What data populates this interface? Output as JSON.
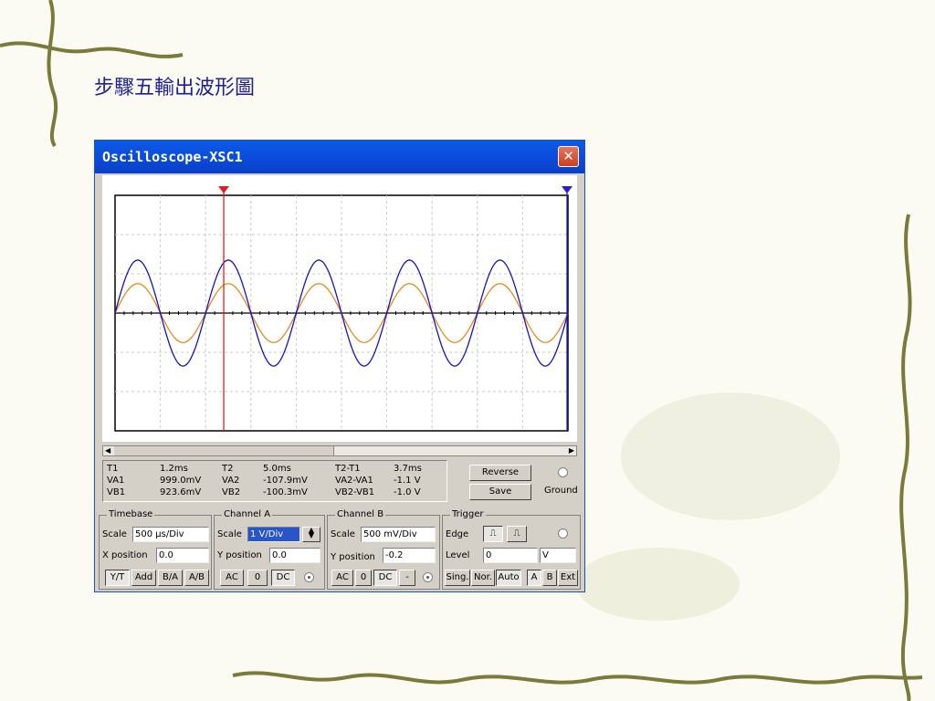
{
  "slide": {
    "title": "步驟五輸出波形圖"
  },
  "window": {
    "title": "Oscilloscope-XSC1",
    "close_glyph": "✕"
  },
  "colors": {
    "ch_a": "#e88a1a",
    "ch_b": "#1414c8",
    "cursor1": "#e02020",
    "cursor2": "#2020d0",
    "grid": "#c8c8c8",
    "titlebar": "#0b49d8"
  },
  "chart_data": {
    "type": "line",
    "x_unit": "ms",
    "xlim": [
      0,
      5.0
    ],
    "ylim": [
      -4,
      4
    ],
    "series": [
      {
        "name": "Channel A",
        "amplitude": 1.0,
        "period": 1.0,
        "phase_offset": 0.0
      },
      {
        "name": "Channel B",
        "amplitude": 1.8,
        "period": 1.0,
        "phase_offset": 0.0
      }
    ],
    "cursor_t1": 1.2,
    "cursor_t2": 5.0,
    "grid": true
  },
  "readout": {
    "t1": {
      "label": "T1",
      "time": "1.2ms",
      "va_label": "VA1",
      "va": "999.0mV",
      "vb_label": "VB1",
      "vb": "923.6mV"
    },
    "t2": {
      "label": "T2",
      "time": "5.0ms",
      "va_label": "VA2",
      "va": "-107.9mV",
      "vb_label": "VB2",
      "vb": "-100.3mV"
    },
    "diff": {
      "label": "T2-T1",
      "time": "3.7ms",
      "va_label": "VA2-VA1",
      "va": "-1.1 V",
      "vb_label": "VB2-VB1",
      "vb": "-1.0 V"
    }
  },
  "buttons": {
    "reverse": "Reverse",
    "save": "Save",
    "ground": "Ground"
  },
  "timebase": {
    "label": "Timebase",
    "scale_label": "Scale",
    "scale": "500 µs/Div",
    "xpos_label": "X position",
    "xpos": "0.0",
    "modes": [
      "Y/T",
      "Add",
      "B/A",
      "A/B"
    ]
  },
  "channel_a": {
    "label": "Channel A",
    "scale_label": "Scale",
    "scale": "1 V/Div",
    "ypos_label": "Y position",
    "ypos": "0.0",
    "coupling": [
      "AC",
      "0",
      "DC"
    ]
  },
  "channel_b": {
    "label": "Channel B",
    "scale_label": "Scale",
    "scale": "500 mV/Div",
    "ypos_label": "Y position",
    "ypos": "-0.2",
    "coupling": [
      "AC",
      "0",
      "DC",
      "-"
    ]
  },
  "trigger": {
    "label": "Trigger",
    "edge_label": "Edge",
    "level_label": "Level",
    "level": "0",
    "unit": "V",
    "modes": [
      "Sing.",
      "Nor.",
      "Auto"
    ],
    "sources": [
      "A",
      "B",
      "Ext"
    ]
  }
}
